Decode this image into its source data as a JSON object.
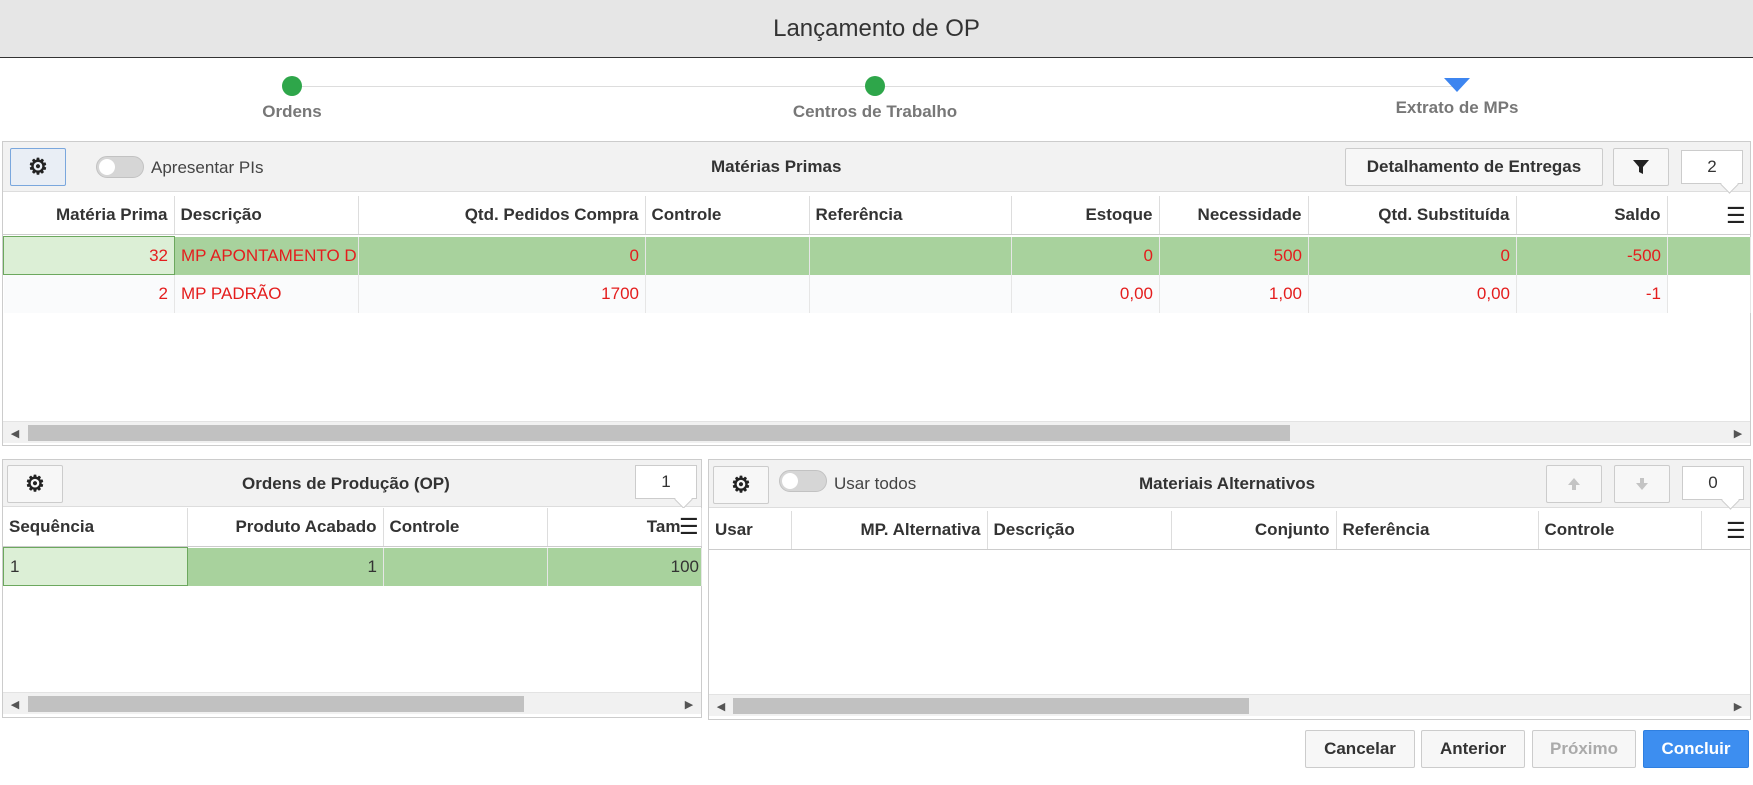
{
  "window": {
    "title": "Lançamento de OP"
  },
  "wizard": {
    "steps": [
      {
        "label": "Ordens",
        "state": "done"
      },
      {
        "label": "Centros de Trabalho",
        "state": "done"
      },
      {
        "label": "Extrato de MPs",
        "state": "current"
      }
    ],
    "colors": {
      "done": "#2ea64a",
      "current": "#3d85f0"
    }
  },
  "materias": {
    "toggle_label": "Apresentar PIs",
    "title": "Matérias Primas",
    "detail_button": "Detalhamento de Entregas",
    "count": "2",
    "columns": [
      "Matéria Prima",
      "Descrição",
      "Qtd. Pedidos Compra",
      "Controle",
      "Referência",
      "Estoque",
      "Necessidade",
      "Qtd. Substituída",
      "Saldo"
    ],
    "rows": [
      [
        "32",
        "MP APONTAMENTO DE",
        "0",
        "",
        "",
        "0",
        "500",
        "0",
        "-500"
      ],
      [
        "2",
        "MP PADRÃO",
        "1700",
        "",
        "",
        "0,00",
        "1,00",
        "0,00",
        "-1"
      ]
    ]
  },
  "ordens": {
    "title": "Ordens de Produção (OP)",
    "count": "1",
    "columns": [
      "Sequência",
      "Produto Acabado",
      "Controle",
      "Tam"
    ],
    "rows": [
      [
        "1",
        "1",
        "",
        "100"
      ]
    ]
  },
  "alternativos": {
    "toggle_label": "Usar todos",
    "title": "Materiais Alternativos",
    "count": "0",
    "columns": [
      "Usar",
      "MP. Alternativa",
      "Descrição",
      "Conjunto",
      "Referência",
      "Controle"
    ]
  },
  "footer": {
    "cancel": "Cancelar",
    "previous": "Anterior",
    "next": "Próximo",
    "finish": "Concluir"
  },
  "icons": {
    "gear": "gear-icon",
    "filter": "filter-icon",
    "menu": "column-menu-icon",
    "up": "arrow-up-icon",
    "down": "arrow-down-icon"
  },
  "colors": {
    "selected_row": "#a8d29d",
    "negative_text": "#e41d1d",
    "primary": "#3d8ef0"
  }
}
